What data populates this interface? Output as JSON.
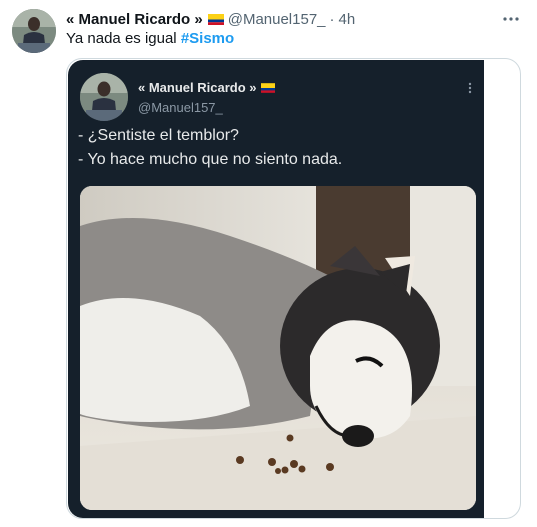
{
  "tweet": {
    "display_name": "« Manuel Ricardo »",
    "handle": "@Manuel157_",
    "separator": "·",
    "time": "4h",
    "text_prefix": "Ya nada es igual ",
    "hashtag": "#Sismo",
    "more_icon": "more-horizontal-icon",
    "flag_icon": "colombia-flag-icon"
  },
  "embedded": {
    "display_name": "« Manuel Ricardo »",
    "handle": "@Manuel157_",
    "line1": "- ¿Sentiste el temblor?",
    "line2": "- Yo hace mucho que no siento nada.",
    "more_icon": "more-vertical-icon",
    "image_description_icon": "meme-photo"
  },
  "colors": {
    "accent": "#1d9bf0",
    "card_bg": "#15202b",
    "text_primary": "#0f1419",
    "text_secondary": "#536471"
  }
}
